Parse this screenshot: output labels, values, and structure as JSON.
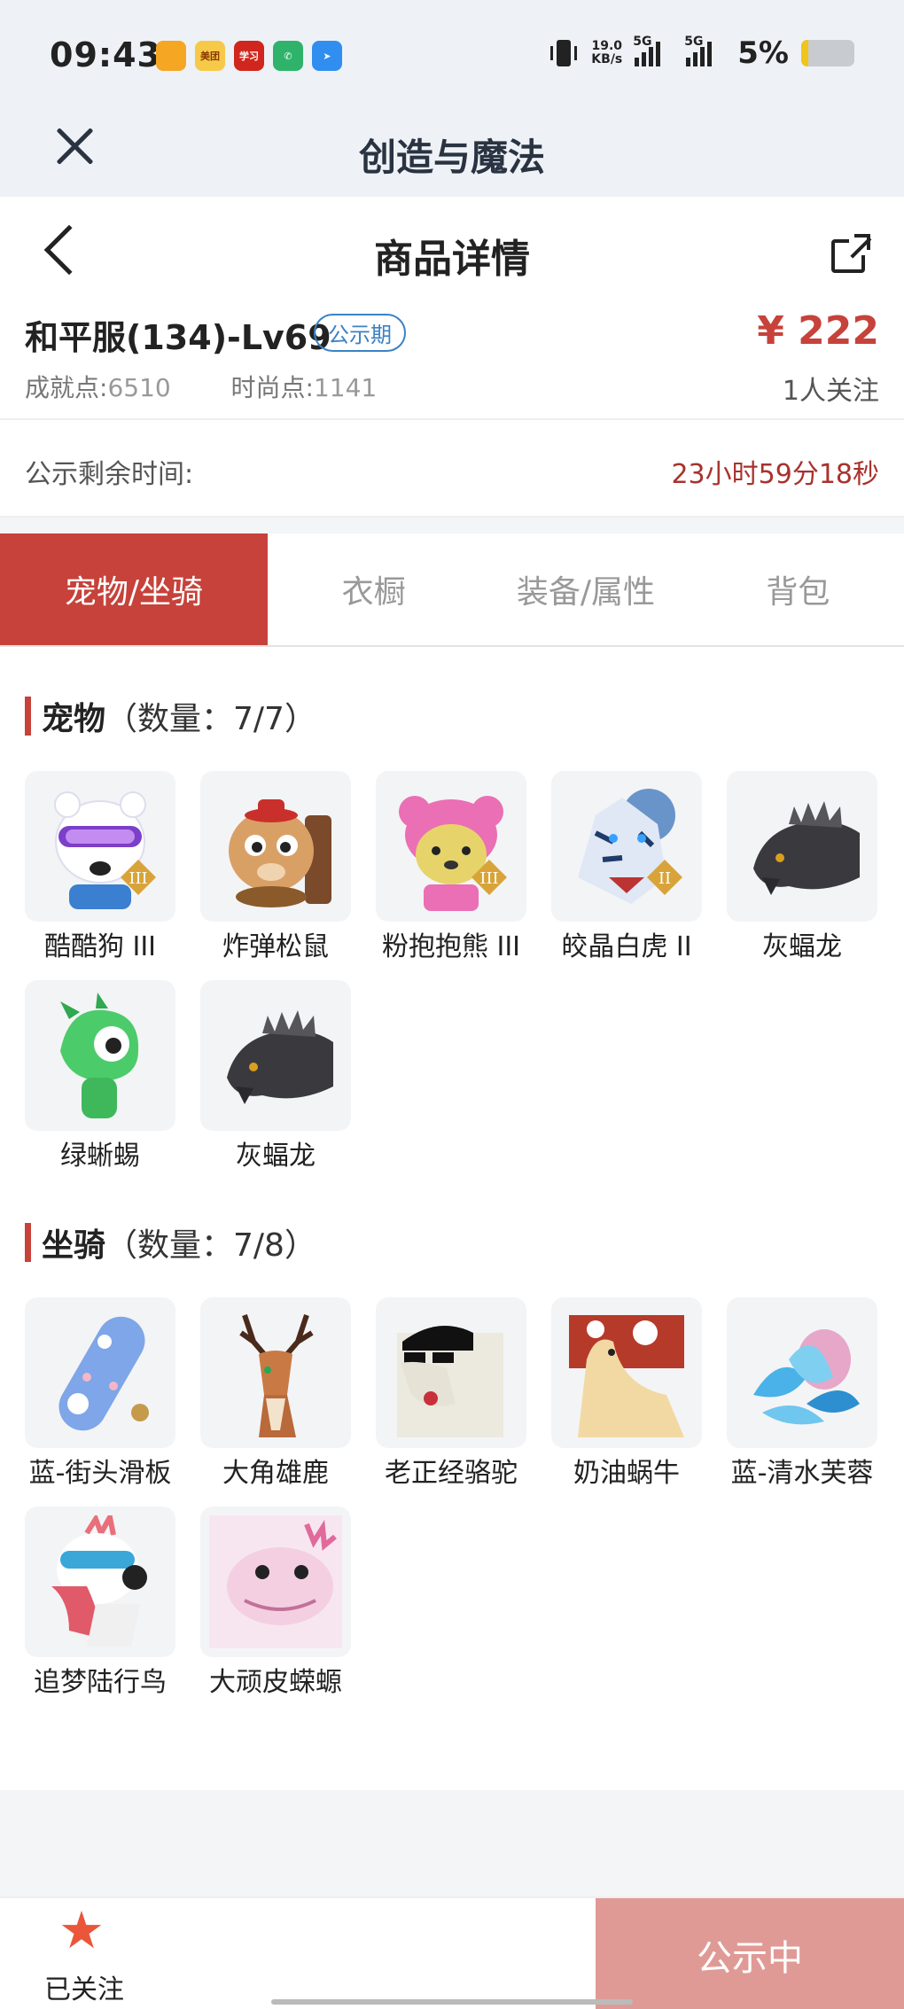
{
  "status_bar": {
    "time": "09:43",
    "apps": [
      {
        "icon": "notes-app-icon",
        "color": "#f5a623",
        "label": ""
      },
      {
        "icon": "meituan-app-icon",
        "color": "#f7c948",
        "label": "美团"
      },
      {
        "icon": "xuexi-app-icon",
        "color": "#d0261d",
        "label": "学习"
      },
      {
        "icon": "phone-app-icon",
        "color": "#2fb36b",
        "label": ""
      },
      {
        "icon": "paper-plane-app-icon",
        "color": "#2f8ef0",
        "label": ""
      }
    ],
    "net_speed_value": "19.0",
    "net_speed_unit": "KB/s",
    "signal_1": "5G",
    "signal_2": "5G",
    "battery": "5%"
  },
  "title_bar": {
    "title": "创造与魔法"
  },
  "nav": {
    "title": "商品详情"
  },
  "listing": {
    "account": "和平服(134)-Lv69",
    "badge": "公示期",
    "stats_achievement_label": "成就点:",
    "stats_achievement_value": "6510",
    "stats_fashion_label": "时尚点:",
    "stats_fashion_value": "1141",
    "price": "¥ 222",
    "followers": "1人关注"
  },
  "remaining": {
    "label": "公示剩余时间:",
    "value": "23小时59分18秒"
  },
  "tabs": [
    "宠物/坐骑",
    "衣橱",
    "装备/属性",
    "背包"
  ],
  "pets": {
    "title": "宠物",
    "count": "（数量：7/7）",
    "items": [
      {
        "name": "酷酷狗 III",
        "icon": "cool-dog-icon"
      },
      {
        "name": "炸弹松鼠",
        "icon": "bomb-squirrel-icon"
      },
      {
        "name": "粉抱抱熊 III",
        "icon": "pink-bear-icon"
      },
      {
        "name": "皎晶白虎 II",
        "icon": "white-tiger-icon"
      },
      {
        "name": "灰蝠龙",
        "icon": "gray-bat-dragon-icon"
      },
      {
        "name": "绿蜥蜴",
        "icon": "green-lizard-icon"
      },
      {
        "name": "灰蝠龙",
        "icon": "gray-bat-dragon-icon"
      }
    ]
  },
  "mounts": {
    "title": "坐骑",
    "count": "（数量：7/8）",
    "items": [
      {
        "name": "蓝-街头滑板",
        "icon": "skateboard-icon"
      },
      {
        "name": "大角雄鹿",
        "icon": "stag-icon"
      },
      {
        "name": "老正经骆驼",
        "icon": "camel-icon"
      },
      {
        "name": "奶油蜗牛",
        "icon": "snail-icon"
      },
      {
        "name": "蓝-清水芙蓉",
        "icon": "lotus-icon"
      },
      {
        "name": "追梦陆行鸟",
        "icon": "bird-icon"
      },
      {
        "name": "大顽皮蝾螈",
        "icon": "salamander-icon"
      }
    ]
  },
  "bottom": {
    "follow_label": "已关注",
    "status_label": "公示中"
  }
}
